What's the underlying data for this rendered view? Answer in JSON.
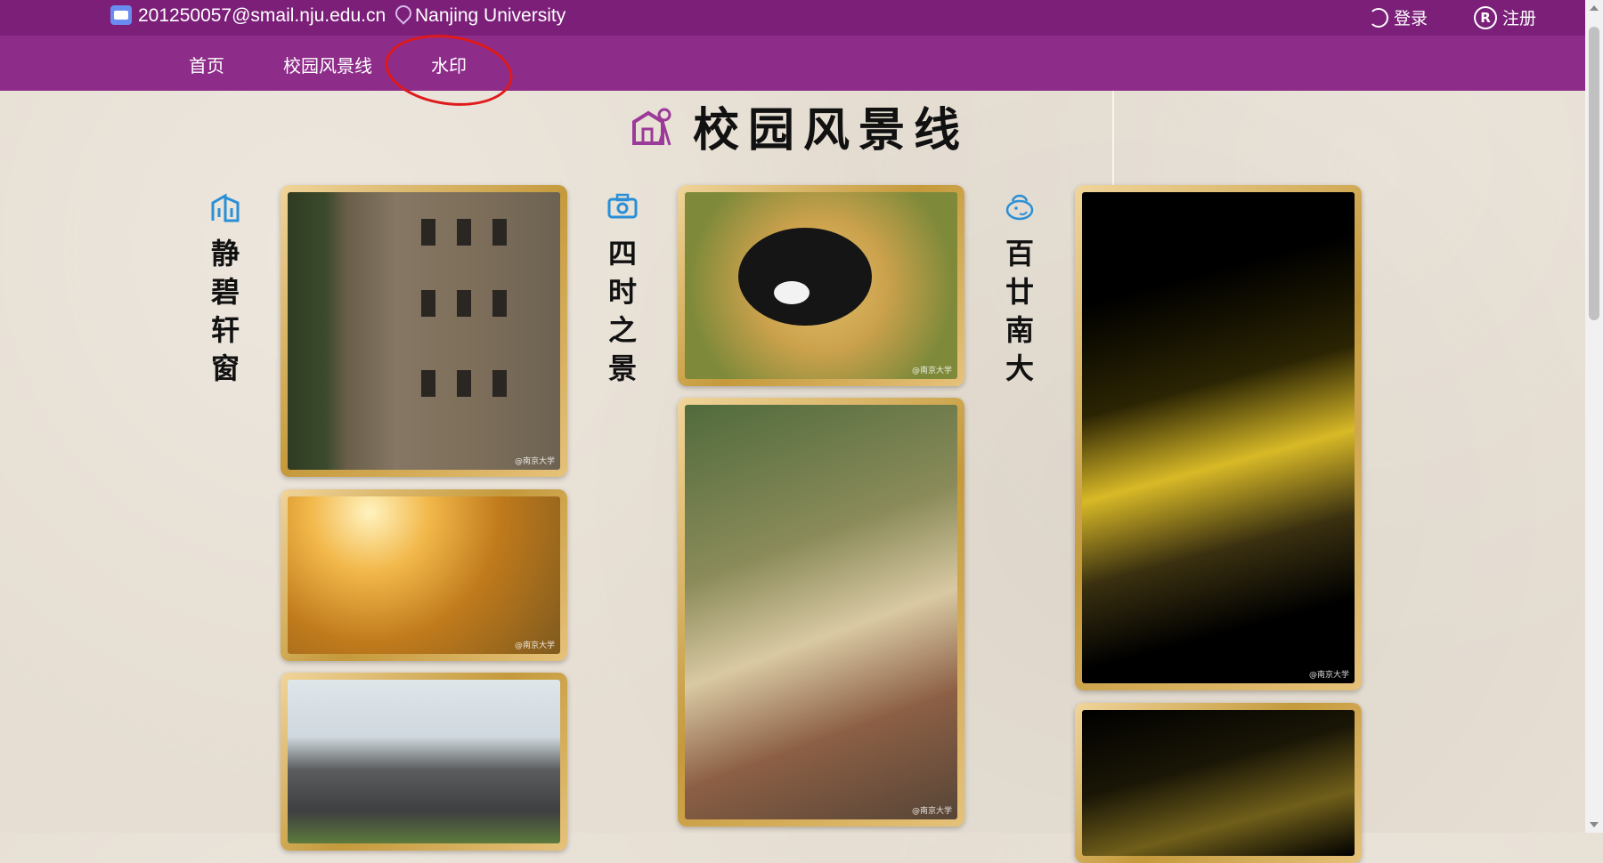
{
  "topbar": {
    "email": "201250057@smail.nju.edu.cn",
    "location": "Nanjing University",
    "login_label": "登录",
    "register_label": "注册",
    "icons": {
      "email": "mail-icon",
      "location": "location-pin-icon",
      "login": "login-icon",
      "register": "register-icon"
    }
  },
  "nav": {
    "items": [
      {
        "label": "首页"
      },
      {
        "label": "校园风景线"
      },
      {
        "label": "水印"
      }
    ]
  },
  "main": {
    "title": "校园风景线",
    "title_icon": "campus-building-icon",
    "sections": [
      {
        "label": "静碧轩窗",
        "icon": "building-chart-icon"
      },
      {
        "label": "四时之景",
        "icon": "camera-icon"
      },
      {
        "label": "百廿南大",
        "icon": "mascot-icon"
      }
    ],
    "watermark": "@南京大学"
  },
  "colors": {
    "topbar": "#7b1f79",
    "navbar": "#8e2c8a",
    "annotation": "#e01a1a",
    "frame_gold": "#c59a3c",
    "section_icon": "#2a8fd6"
  }
}
